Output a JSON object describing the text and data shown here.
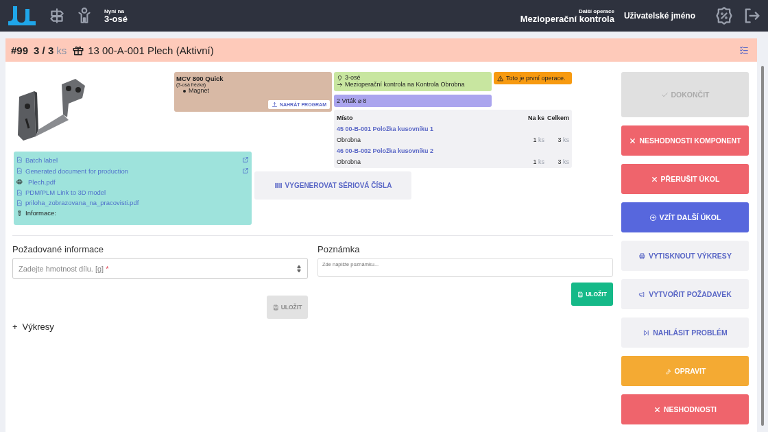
{
  "header": {
    "now_label": "Nyní na",
    "now_value": "3-osé",
    "next_label": "Další operace",
    "next_value": "Mezioperační kontrola",
    "user": "Uživatelské jméno"
  },
  "task": {
    "number": "#99",
    "done": "3",
    "sep": "/",
    "total": "3",
    "unit": "ks",
    "part": "13 00-A-001 Plech (Aktivní)"
  },
  "documents": [
    {
      "kind": "pdf",
      "label": "Batch label",
      "external": true
    },
    {
      "kind": "pdf",
      "label": "Generated document for production",
      "external": true
    },
    {
      "kind": "print",
      "label": "Plech.pdf",
      "external": false
    },
    {
      "kind": "pdf",
      "label": "PDM/PLM Link to 3D model",
      "external": false
    },
    {
      "kind": "pdf",
      "label": "priloha_zobrazovana_na_pracovisti.pdf",
      "external": false
    },
    {
      "kind": "info",
      "label": "Informace:",
      "external": false
    }
  ],
  "machine": {
    "name": "MCV 800 Quick",
    "type": "(3-osá frézka)",
    "tools": [
      "Magnet"
    ],
    "button": "NAHRÁT PROGRAM"
  },
  "workplace": {
    "name": "3-osé",
    "next": "Mezioperační kontrola na  Kontrola  Obrobna"
  },
  "tool": "2 Vrták ⌀ 8",
  "warning": "Toto je první operace.",
  "components": {
    "columns": [
      "Místo",
      "Na ks",
      "Celkem"
    ],
    "rows": [
      {
        "item": "45 00-B-001 Položka kusovníku 1",
        "place": "Obrobna",
        "per_piece": "1",
        "per_piece_unit": "ks",
        "total": "3",
        "total_unit": "ks"
      },
      {
        "item": "46 00-B-002 Položka kusovníku 2",
        "place": "Obrobna",
        "per_piece": "1",
        "per_piece_unit": "ks",
        "total": "3",
        "total_unit": "ks"
      }
    ]
  },
  "serial_button": "VYGENEROVAT SÉRIOVÁ ČÍSLA",
  "required_info": {
    "title": "Požadované informace",
    "placeholder": "Zadejte hmotnost dílu. [g]",
    "required_mark": "*",
    "save": "ULOŽIT",
    "save_disabled": true
  },
  "note": {
    "title": "Poznámka",
    "placeholder": "Zde napište poznámku...",
    "save": "ULOŽIT",
    "save_disabled": false
  },
  "drawings": {
    "toggle": "+",
    "label": "Výkresy",
    "expanded": false
  },
  "actions": [
    {
      "kind": "disabled",
      "label": "DOKONČIT"
    },
    {
      "kind": "danger",
      "label": "NESHODNOSTI KOMPONENT"
    },
    {
      "kind": "danger",
      "label": "PŘERUŠIT ÚKOL"
    },
    {
      "kind": "primary",
      "label": "VZÍT DALŠÍ ÚKOL"
    },
    {
      "kind": "light",
      "label": "VYTISKNOUT VÝKRESY"
    },
    {
      "kind": "light",
      "label": "VYTVOŘIT POŽADAVEK"
    },
    {
      "kind": "light",
      "label": "NAHLÁSIT PROBLÉM"
    },
    {
      "kind": "warning",
      "label": "OPRAVIT"
    },
    {
      "kind": "danger",
      "label": "NESHODNOSTI"
    }
  ]
}
